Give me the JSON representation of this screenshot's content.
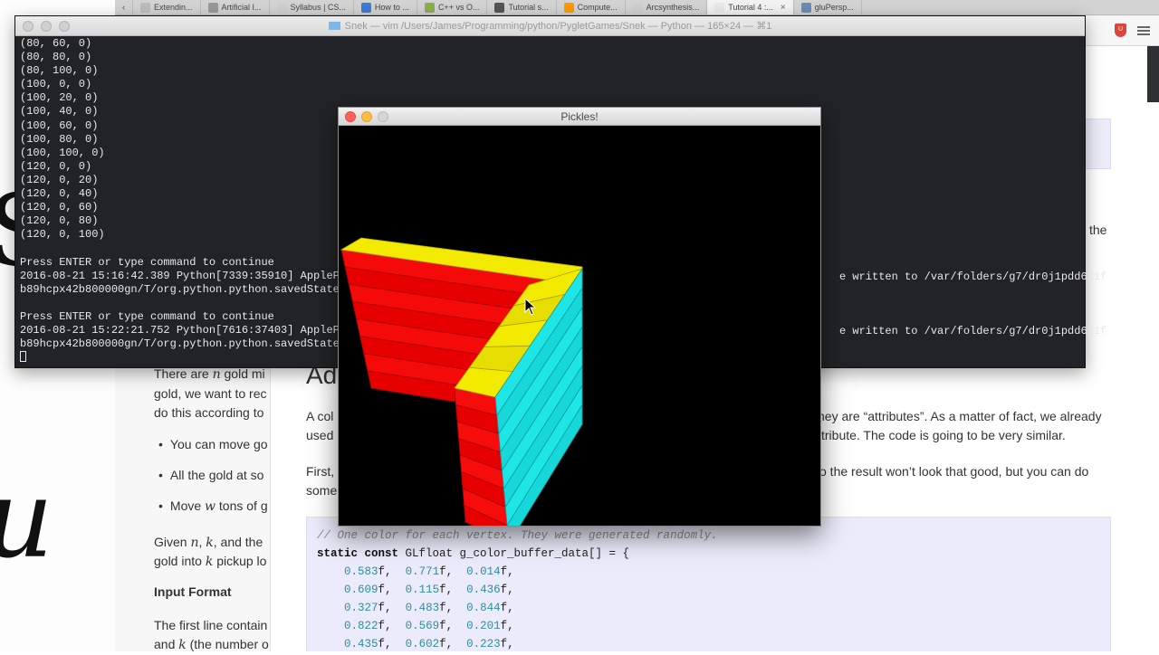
{
  "browser": {
    "tabs": [
      {
        "label": "Extendin...",
        "favicon_color": "#bdbdbd",
        "active": false
      },
      {
        "label": "Artificial I...",
        "favicon_color": "#9a9a9a",
        "active": false
      },
      {
        "label": "Syllabus | CS...",
        "favicon_color": "#cfcfcf",
        "active": false
      },
      {
        "label": "How to ...",
        "favicon_color": "#3b7dd8",
        "active": false
      },
      {
        "label": "C++ vs O...",
        "favicon_color": "#8bb04f",
        "active": false
      },
      {
        "label": "Tutorial s...",
        "favicon_color": "#555555",
        "active": false
      },
      {
        "label": "Compute...",
        "favicon_color": "#ff9900",
        "active": false
      },
      {
        "label": "Arcsynthesis...",
        "favicon_color": "#cfcfcf",
        "active": false
      },
      {
        "label": "Tutorial 4 :...",
        "favicon_color": "#e9e9e9",
        "active": true
      },
      {
        "label": "gluPersp...",
        "favicon_color": "#6d8bb8",
        "active": false
      }
    ],
    "toolbar": {
      "shield_badge": "U"
    }
  },
  "page_fragments": {
    "right_fragment": "the",
    "problem": {
      "line1_prefix": "There are ",
      "line1_var": "n",
      "line1_suffix": " gold mi",
      "line2": "gold, we want to rec",
      "line3": "do this according to",
      "bullet1": "You can move go",
      "bullet2": "All the gold at so",
      "bullet3_prefix": "Move ",
      "bullet3_var": "w",
      "bullet3_suffix": " tons of g",
      "given_prefix": "Given ",
      "given_n": "n",
      "given_sep1": ", ",
      "given_k": "k",
      "given_suffix": ", and the",
      "gold_prefix": "gold into ",
      "gold_k": "k",
      "gold_suffix": " pickup lo",
      "input_format": "Input Format",
      "first_line": "The first line contain",
      "and_prefix": "and ",
      "and_k": "k",
      "and_suffix": " (the number o"
    },
    "tutorial": {
      "heading": "Ad",
      "para1_left": "A col",
      "para1_right": "hey are “attributes”. As a matter of fact, we already",
      "para2_left": "used",
      "para2_right": "tribute. The code is going to be very similar.",
      "para3_left": "First,",
      "para3_right": "o the result won’t look that good, but you can do",
      "para4_left": "some",
      "code": {
        "comment": "// One color for each vertex. They were generated randomly.",
        "decl_kw": "static const",
        "decl_rest": " GLfloat g_color_buffer_data[] = {",
        "rows": [
          [
            "0.583",
            "0.771",
            "0.014"
          ],
          [
            "0.609",
            "0.115",
            "0.436"
          ],
          [
            "0.327",
            "0.483",
            "0.844"
          ],
          [
            "0.822",
            "0.569",
            "0.201"
          ],
          [
            "0.435",
            "0.602",
            "0.223"
          ]
        ],
        "suffix": "f,"
      }
    }
  },
  "terminal": {
    "title": "Snek — vim  /Users/James/Programming/python/PygletGames/Snek — Python — 165×24 — ⌘1",
    "lines": [
      "(80, 60, 0)",
      "(80, 80, 0)",
      "(80, 100, 0)",
      "(100, 0, 0)",
      "(100, 20, 0)",
      "(100, 40, 0)",
      "(100, 60, 0)",
      "(100, 80, 0)",
      "(100, 100, 0)",
      "(120, 0, 0)",
      "(120, 0, 20)",
      "(120, 0, 40)",
      "(120, 0, 60)",
      "(120, 0, 80)",
      "(120, 0, 100)",
      "",
      "Press ENTER or type command to continue",
      "2016-08-21 15:16:42.389 Python[7339:35910] ApplePe",
      "b89hcpx42b800000gn/T/org.python.python.savedState",
      "",
      "Press ENTER or type command to continue",
      "2016-08-21 15:22:21.752 Python[7616:37403] ApplePe",
      "b89hcpx42b800000gn/T/org.python.python.savedState"
    ],
    "tail1": "e written to /var/folders/g7/dr0j1pdd621f",
    "tail2": "e written to /var/folders/g7/dr0j1pdd621f"
  },
  "pickles_window": {
    "title": "Pickles!",
    "colors": {
      "red": "#ee0000",
      "yellow": "#f2ea00",
      "cyan": "#1fe6e6"
    }
  }
}
